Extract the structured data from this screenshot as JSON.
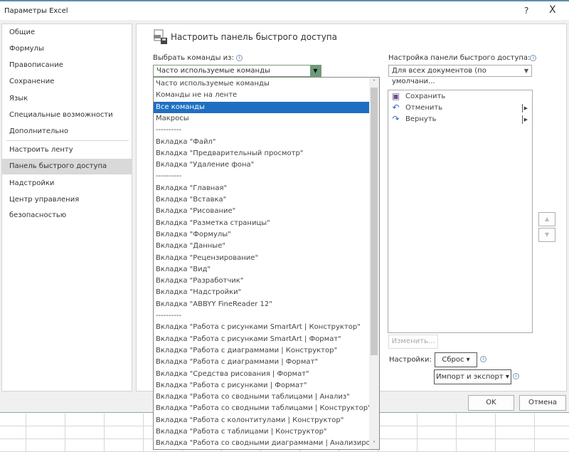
{
  "window": {
    "title": "Параметры Excel",
    "help": "?",
    "close": "X"
  },
  "sidebar": {
    "items": [
      {
        "label": "Общие"
      },
      {
        "label": "Формулы"
      },
      {
        "label": "Правописание"
      },
      {
        "label": "Сохранение"
      },
      {
        "label": "Язык"
      },
      {
        "label": "Специальные возможности"
      },
      {
        "label": "Дополнительно"
      },
      {
        "label": "Настроить ленту"
      },
      {
        "label": "Панель быстрого доступа",
        "selected": true
      },
      {
        "label": "Надстройки"
      },
      {
        "label": "Центр управления безопасностью"
      }
    ]
  },
  "main": {
    "heading": "Настроить панель быстрого доступа",
    "choose_label": "Выбрать команды из:",
    "choose_value": "Часто используемые команды",
    "dropdown_options": [
      "Часто используемые команды",
      "Команды не на ленте",
      "Все команды",
      "Макросы",
      "----------",
      "Вкладка \"Файл\"",
      "Вкладка \"Предварительный просмотр\"",
      "Вкладка \"Удаление фона\"",
      "----------",
      "Вкладка \"Главная\"",
      "Вкладка \"Вставка\"",
      "Вкладка \"Рисование\"",
      "Вкладка \"Разметка страницы\"",
      "Вкладка \"Формулы\"",
      "Вкладка \"Данные\"",
      "Вкладка \"Рецензирование\"",
      "Вкладка \"Вид\"",
      "Вкладка \"Разработчик\"",
      "Вкладка \"Надстройки\"",
      "Вкладка \"ABBYY FineReader 12\"",
      "----------",
      "Вкладка \"Работа с рисунками SmartArt | Конструктор\"",
      "Вкладка \"Работа с рисунками SmartArt | Формат\"",
      "Вкладка \"Работа с диаграммами | Конструктор\"",
      "Вкладка \"Работа с диаграммами | Формат\"",
      "Вкладка \"Средства рисования | Формат\"",
      "Вкладка \"Работа с рисунками | Формат\"",
      "Вкладка \"Работа со сводными таблицами | Анализ\"",
      "Вкладка \"Работа со сводными таблицами | Конструктор\"",
      "Вкладка \"Работа с колонтитулами | Конструктор\"",
      "Вкладка \"Работа с таблицами | Конструктор\"",
      "Вкладка \"Работа со сводными диаграммами | Анализировать\""
    ],
    "dropdown_selected": "Все команды",
    "customize_label": "Настройка панели быстрого доступа:",
    "customize_value": "Для всех документов (по умолчани...",
    "qat_items": [
      {
        "label": "Сохранить",
        "icon": "save-icon"
      },
      {
        "label": "Отменить",
        "icon": "undo-icon"
      },
      {
        "label": "Вернуть",
        "icon": "redo-icon"
      }
    ],
    "modify_label": "Изменить...",
    "settings_label": "Настройки:",
    "reset_label": "Сброс ▾",
    "import_label": "Импорт и экспорт ▾"
  },
  "footer": {
    "ok": "OK",
    "cancel": "Отмена"
  },
  "colors": {
    "selection": "#1e6fc2",
    "sidebar_selected": "#d9d9d9",
    "dropdown_button": "#6d9b7a"
  }
}
